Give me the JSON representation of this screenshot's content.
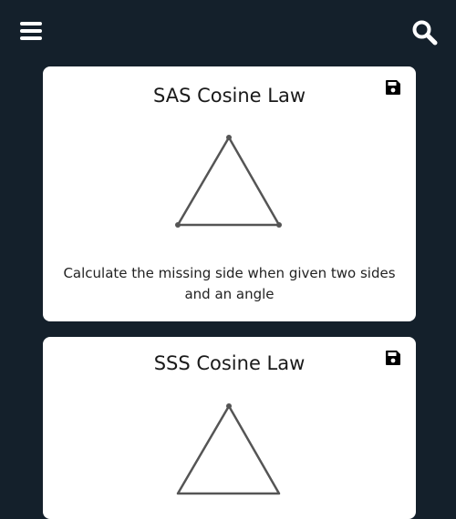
{
  "header": {
    "menu_icon": "hamburger-menu-icon",
    "search_icon": "search-icon"
  },
  "colors": {
    "background": "#14202b",
    "card": "#ffffff",
    "icon": "#ffffff",
    "triangle_stroke": "#555555"
  },
  "cards": [
    {
      "title": "SAS Cosine Law",
      "description": "Calculate the missing side when given two sides and an angle",
      "save_icon": "save-icon",
      "diagram_icon": "triangle-icon"
    },
    {
      "title": "SSS Cosine Law",
      "description": "",
      "save_icon": "save-icon",
      "diagram_icon": "triangle-icon"
    }
  ]
}
